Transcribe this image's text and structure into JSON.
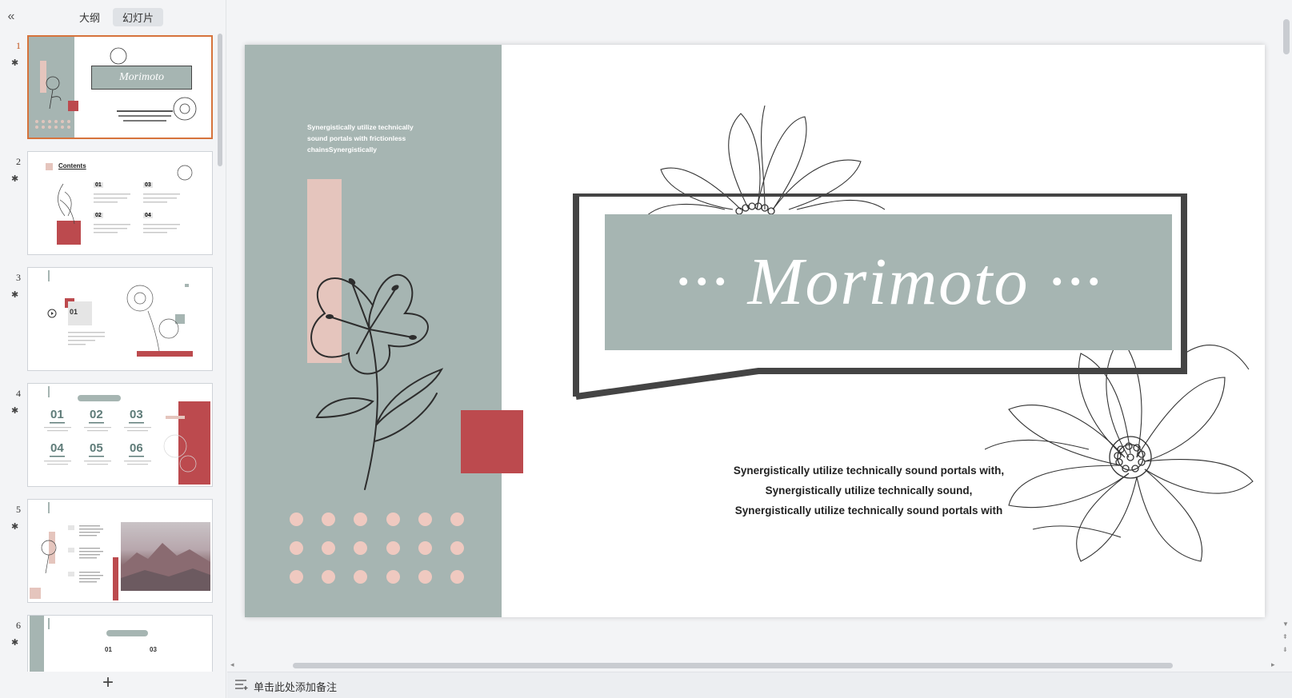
{
  "sidebar": {
    "collapse_icon": "double-chevron-left",
    "tabs": [
      {
        "label": "大纲",
        "active": false
      },
      {
        "label": "幻灯片",
        "active": true
      }
    ],
    "slides": [
      {
        "number": "1",
        "title": "Morimoto",
        "active": true
      },
      {
        "number": "2",
        "title": "Contents",
        "items": [
          "01",
          "02",
          "03",
          "04"
        ]
      },
      {
        "number": "3",
        "title": "01"
      },
      {
        "number": "4",
        "items": [
          "01",
          "02",
          "03",
          "04",
          "05",
          "06"
        ]
      },
      {
        "number": "5"
      },
      {
        "number": "6",
        "items": [
          "01",
          "03"
        ]
      }
    ],
    "star_icon": "animation-star",
    "add_icon": "plus"
  },
  "slide": {
    "small_text": "Synergistically utilize technically sound portals with frictionless chainsSynergistically",
    "title": "··· Morimoto ···",
    "subtitle": "Synergistically utilize technically sound portals with, Synergistically utilize technically sound, Synergistically utilize technically sound portals with"
  },
  "notes": {
    "placeholder": "单击此处添加备注"
  },
  "colors": {
    "sage": "#a6b5b2",
    "pink": "#e5c5bd",
    "red": "#bc4a4e",
    "dot": "#efc9c0",
    "active_border": "#d6733c"
  }
}
